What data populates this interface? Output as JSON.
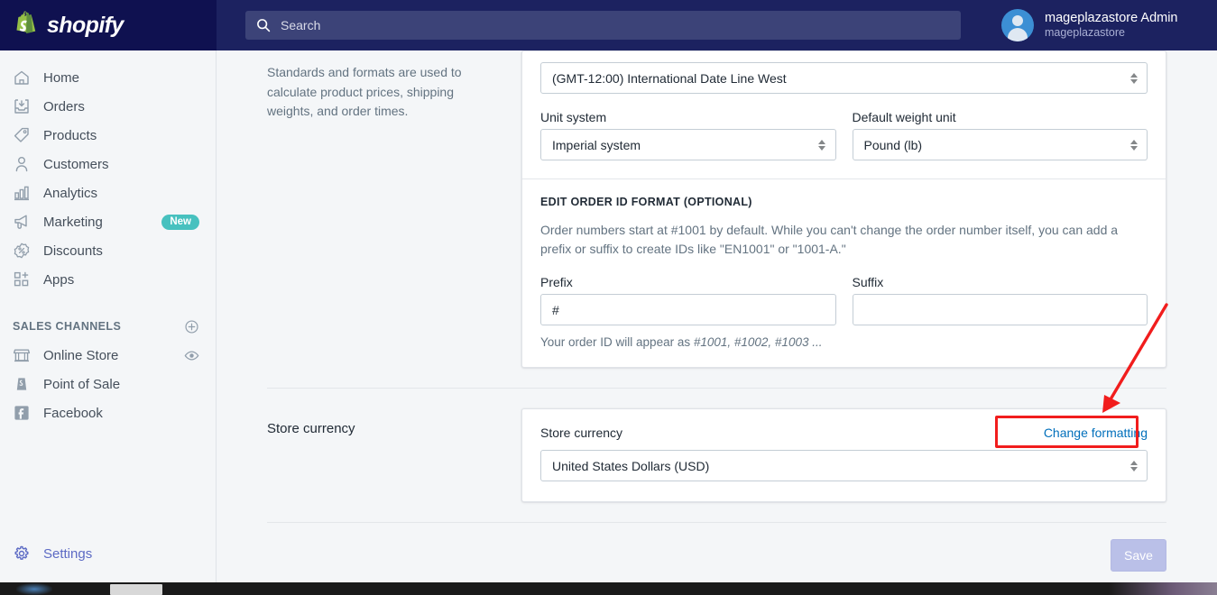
{
  "brand": {
    "name": "shopify",
    "logo_icon": "shopify-bag-icon",
    "header_bg": "#1c2260",
    "accent": "#5c6ac4"
  },
  "search": {
    "placeholder": "Search",
    "icon": "search-icon"
  },
  "user": {
    "name": "mageplazastore Admin",
    "store": "mageplazastore",
    "avatar_icon": "user-avatar-icon"
  },
  "sidebar": {
    "items": [
      {
        "label": "Home",
        "icon": "home-icon"
      },
      {
        "label": "Orders",
        "icon": "orders-inbox-icon"
      },
      {
        "label": "Products",
        "icon": "product-tag-icon"
      },
      {
        "label": "Customers",
        "icon": "customer-person-icon"
      },
      {
        "label": "Analytics",
        "icon": "analytics-bar-chart-icon"
      },
      {
        "label": "Marketing",
        "icon": "marketing-megaphone-icon",
        "badge": "New"
      },
      {
        "label": "Discounts",
        "icon": "discount-percent-icon"
      },
      {
        "label": "Apps",
        "icon": "apps-grid-plus-icon"
      }
    ],
    "sales_channels": {
      "title": "SALES CHANNELS",
      "add_icon": "plus-circle-icon",
      "items": [
        {
          "label": "Online Store",
          "icon": "online-store-icon",
          "trailing_icon": "eye-icon"
        },
        {
          "label": "Point of Sale",
          "icon": "point-of-sale-icon"
        },
        {
          "label": "Facebook",
          "icon": "facebook-icon"
        }
      ]
    },
    "settings": {
      "label": "Settings",
      "icon": "gear-icon",
      "active": true
    }
  },
  "standards": {
    "description": "Standards and formats are used to calculate product prices, shipping weights, and order times.",
    "timezone_value": "(GMT-12:00) International Date Line West",
    "unit_system_label": "Unit system",
    "unit_system_value": "Imperial system",
    "weight_unit_label": "Default weight unit",
    "weight_unit_value": "Pound (lb)"
  },
  "order_id": {
    "heading": "EDIT ORDER ID FORMAT (OPTIONAL)",
    "body": "Order numbers start at #1001 by default. While you can't change the order number itself, you can add a prefix or suffix to create IDs like \"EN1001\" or \"1001-A.\"",
    "prefix_label": "Prefix",
    "prefix_value": "#",
    "suffix_label": "Suffix",
    "suffix_value": "",
    "hint_prefix": "Your order ID will appear as ",
    "hint_example": "#1001, #1002, #1003 ..."
  },
  "store_currency": {
    "section_label": "Store currency",
    "field_label": "Store currency",
    "change_link": "Change formatting",
    "value": "United States Dollars (USD)"
  },
  "footer": {
    "save_label": "Save"
  },
  "annotation": {
    "color": "#f11d1d",
    "target": "change-formatting-link"
  }
}
